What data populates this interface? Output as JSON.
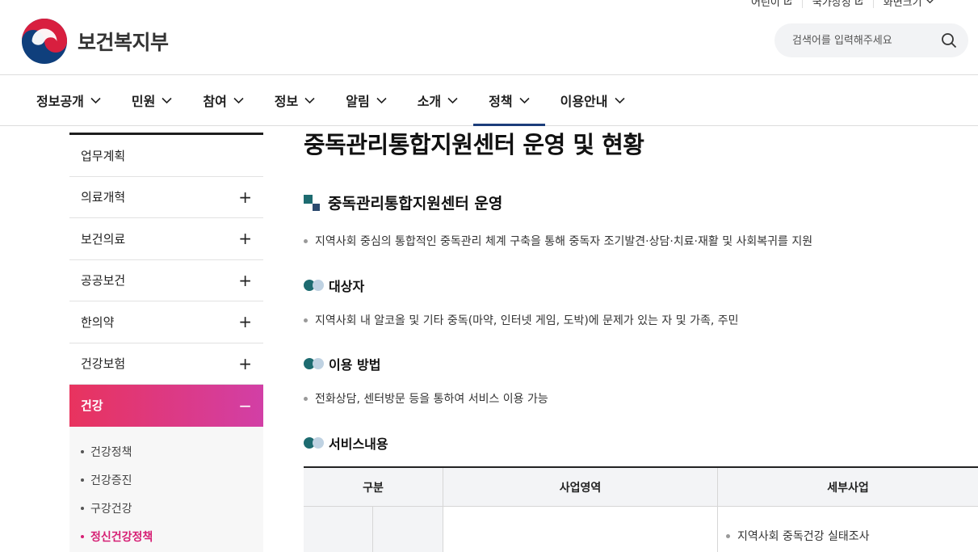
{
  "util": {
    "items": [
      {
        "label": "어린이"
      },
      {
        "label": "국가상징"
      },
      {
        "label": "화면크기"
      }
    ]
  },
  "logo": {
    "text": "보건복지부"
  },
  "search": {
    "placeholder": "검색어를 입력해주세요"
  },
  "gnb": {
    "items": [
      {
        "label": "정보공개"
      },
      {
        "label": "민원"
      },
      {
        "label": "참여"
      },
      {
        "label": "정보"
      },
      {
        "label": "알림"
      },
      {
        "label": "소개"
      },
      {
        "label": "정책"
      },
      {
        "label": "이용안내"
      }
    ]
  },
  "lnb": {
    "items": [
      {
        "label": "업무계획"
      },
      {
        "label": "의료개혁",
        "toggle": "+"
      },
      {
        "label": "보건의료",
        "toggle": "+"
      },
      {
        "label": "공공보건",
        "toggle": "+"
      },
      {
        "label": "한의약",
        "toggle": "+"
      },
      {
        "label": "건강보험",
        "toggle": "+"
      },
      {
        "label": "건강",
        "toggle": "−"
      }
    ],
    "sub": [
      {
        "label": "건강정책"
      },
      {
        "label": "건강증진"
      },
      {
        "label": "구강건강"
      },
      {
        "label": "정신건강정책"
      }
    ]
  },
  "content": {
    "title": "중독관리통합지원센터 운영 및 현황",
    "section_title": "중독관리통합지원센터 운영",
    "intro": "지역사회 중심의 통합적인 중독관리 체계 구축을 통해 중독자 조기발견·상담·치료·재활 및 사회복귀를 지원",
    "target_title": "대상자",
    "target_text": "지역사회 내 알코올 및 기타 중독(마약, 인터넷 게임, 도박)에 문제가 있는 자 및 가족, 주민",
    "usage_title": "이용 방법",
    "usage_text": "전화상담, 센터방문 등을 통하여 서비스 이용 가능",
    "service_title": "서비스내용"
  },
  "table": {
    "headers": [
      "구분",
      "사업영역",
      "세부사업"
    ],
    "rows": [
      {
        "detail": "지역사회 중독건강 실태조사"
      }
    ]
  },
  "colors": {
    "active_gradient_start": "#e8335e",
    "active_gradient_end": "#d23fa6",
    "current_sub": "#d61f74",
    "gnb_active_bar": "#1c3d7a"
  }
}
